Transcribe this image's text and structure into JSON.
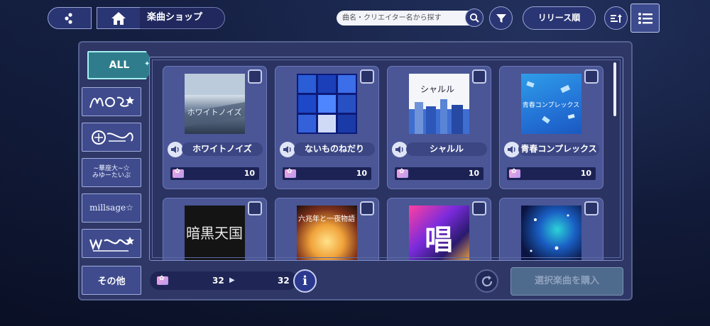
{
  "header": {
    "title": "楽曲ショップ",
    "search_placeholder": "曲名・クリエイター名から探す",
    "sort_label": "リリース順"
  },
  "tabs": [
    {
      "label": "ALL",
      "selected": true
    },
    {
      "label": "MORE MORE JUMP!",
      "logo": true
    },
    {
      "label": "Leo/need",
      "logo": true
    },
    {
      "label": "25時、ナイトコードで。",
      "logo": true
    },
    {
      "label": "millsage",
      "logo": true
    },
    {
      "label": "ワンダーランズ×ショウタイム",
      "logo": true
    },
    {
      "label": "その他"
    }
  ],
  "songs": [
    {
      "title": "ホワイトノイズ",
      "price": "10",
      "jacket_text": "ホワイトノイズ"
    },
    {
      "title": "ないものねだり",
      "price": "10",
      "jacket_text": ""
    },
    {
      "title": "シャルル",
      "price": "10",
      "jacket_text": "シャルル"
    },
    {
      "title": "青春コンプレックス",
      "price": "10",
      "jacket_text": "青春コンプレックス"
    },
    {
      "title": "",
      "price": "",
      "jacket_text": "暗黒天国"
    },
    {
      "title": "",
      "price": "",
      "jacket_text": "六兆年と一夜物語"
    },
    {
      "title": "",
      "price": "",
      "jacket_text": "唱"
    },
    {
      "title": "",
      "price": "",
      "jacket_text": ""
    }
  ],
  "footer": {
    "owned": "32",
    "after": "32",
    "info_label": "i",
    "buy_label": "選択楽曲を購入"
  },
  "icons": {
    "group": "group-icon",
    "home": "home-icon",
    "search": "search-icon",
    "filter": "filter-icon",
    "sort_direction": "sort-direction-icon",
    "list": "list-icon",
    "speaker": "speaker-icon",
    "ticket": "ticket-icon",
    "reload": "reload-icon"
  },
  "colors": {
    "accent": "#2f7d8c",
    "panel": "#2e3766",
    "card": "#4a5696"
  }
}
